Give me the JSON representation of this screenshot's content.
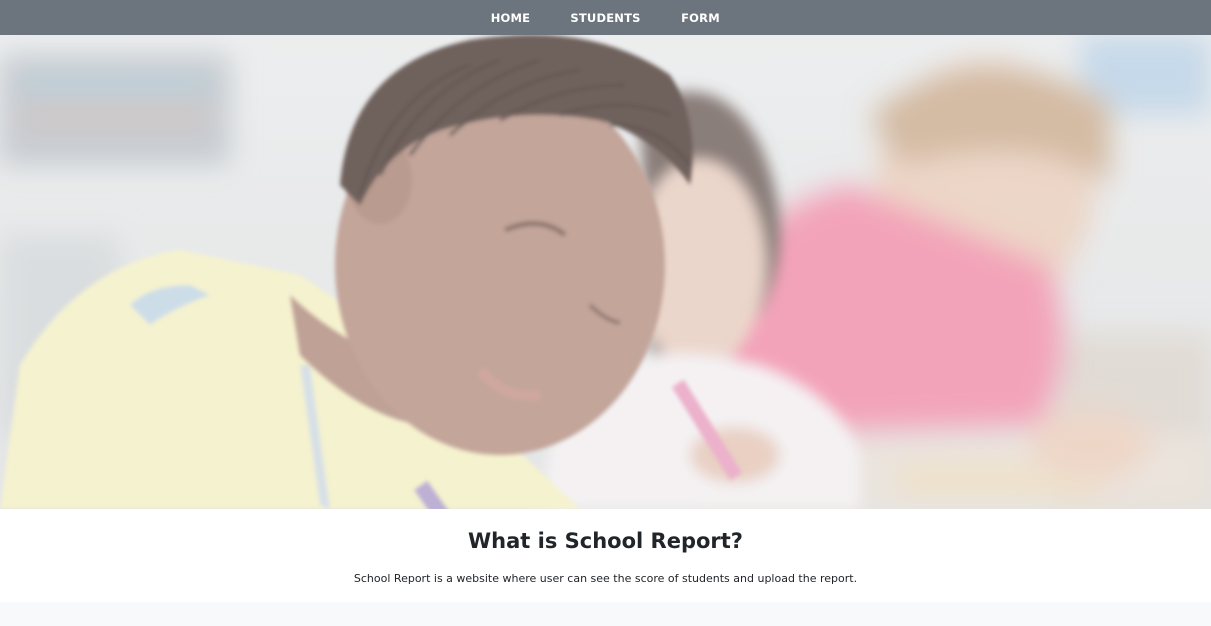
{
  "nav": {
    "items": [
      {
        "label": "HOME"
      },
      {
        "label": "STUDENTS"
      },
      {
        "label": "FORM"
      }
    ]
  },
  "hero": {
    "image": "students-writing-photo"
  },
  "about": {
    "title": "What is School Report?",
    "text": "School Report is a website where user can see the score of students and upload the report."
  },
  "colors": {
    "navbar": "#6c757d",
    "text": "#212529",
    "footer": "#f8f9fa"
  }
}
